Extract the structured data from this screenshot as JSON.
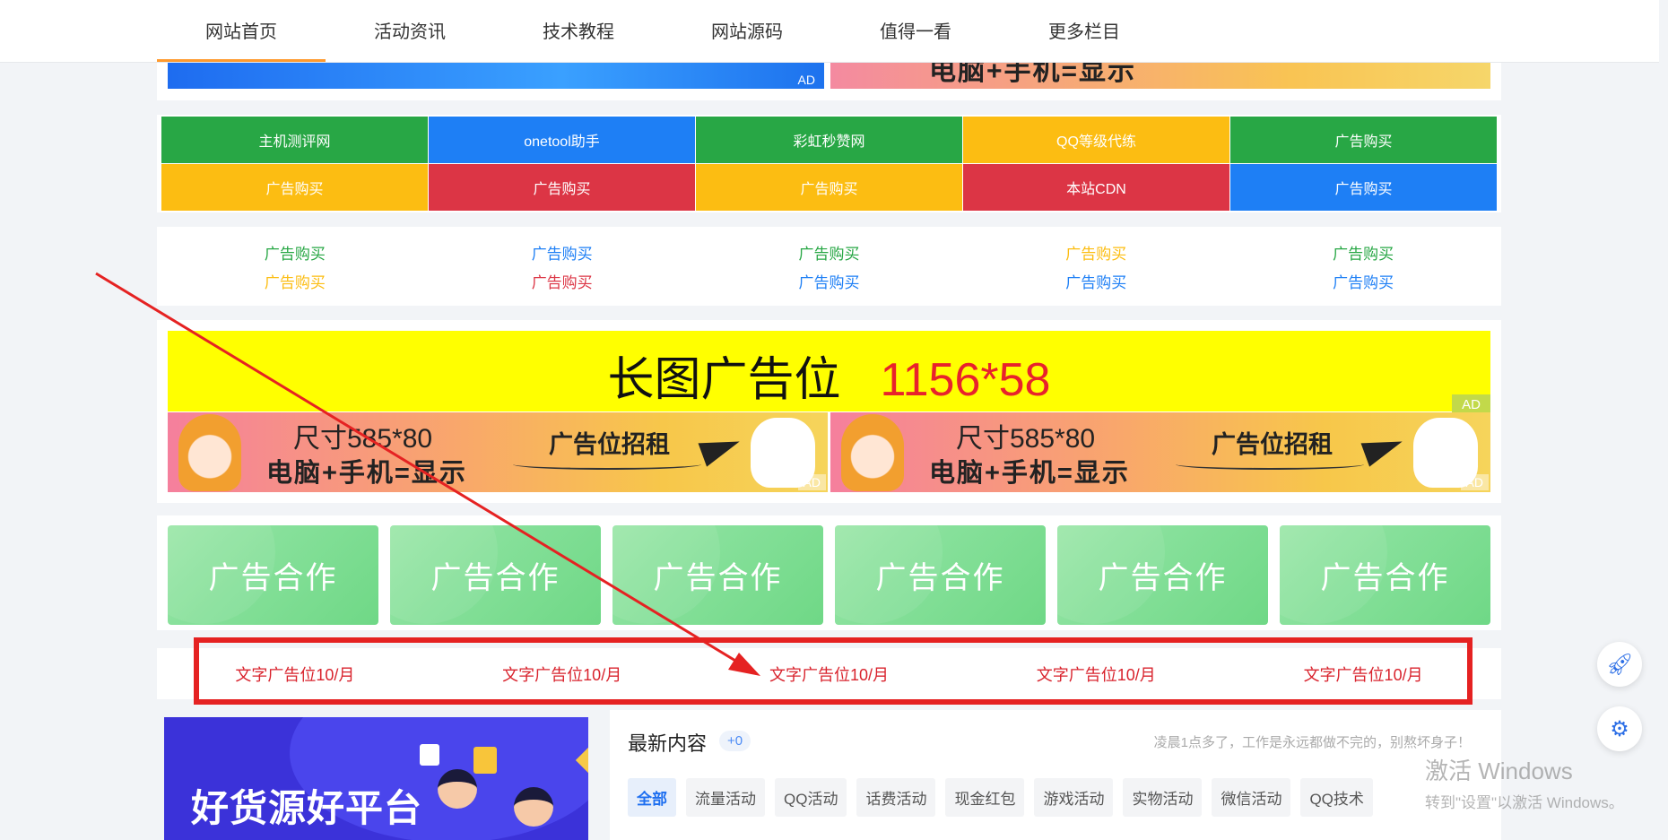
{
  "nav": {
    "items": [
      "网站首页",
      "活动资讯",
      "技术教程",
      "网站源码",
      "值得一看",
      "更多栏目"
    ]
  },
  "banner_top": {
    "right_text": "电脑+手机=显示",
    "ad_label": "AD"
  },
  "colored_links": [
    {
      "label": "主机测评网",
      "color": "#28a745"
    },
    {
      "label": "onetool助手",
      "color": "#1e7ff5"
    },
    {
      "label": "彩虹秒赞网",
      "color": "#28a745"
    },
    {
      "label": "QQ等级代练",
      "color": "#fcbd12"
    },
    {
      "label": "广告购买",
      "color": "#28a745"
    },
    {
      "label": "广告购买",
      "color": "#fcbd12"
    },
    {
      "label": "广告购买",
      "color": "#dc3545"
    },
    {
      "label": "广告购买",
      "color": "#fcbd12"
    },
    {
      "label": "本站CDN",
      "color": "#dc3545"
    },
    {
      "label": "广告购买",
      "color": "#1e7ff5"
    }
  ],
  "text_links": [
    {
      "label": "广告购买",
      "color": "#28a745"
    },
    {
      "label": "广告购买",
      "color": "#1e7ff5"
    },
    {
      "label": "广告购买",
      "color": "#28a745"
    },
    {
      "label": "广告购买",
      "color": "#fcbd12"
    },
    {
      "label": "广告购买",
      "color": "#28a745"
    },
    {
      "label": "广告购买",
      "color": "#fcbd12"
    },
    {
      "label": "广告购买",
      "color": "#dc3545"
    },
    {
      "label": "广告购买",
      "color": "#1e7ff5"
    },
    {
      "label": "广告购买",
      "color": "#1e7ff5"
    },
    {
      "label": "广告购买",
      "color": "#1e7ff5"
    }
  ],
  "long_banner": {
    "main": "长图广告位",
    "size": "1156*58",
    "ad_label": "AD"
  },
  "half_banners": [
    {
      "size": "尺寸585*80",
      "device": "电脑+手机=显示",
      "rent": "广告位招租",
      "ad_label": "AD"
    },
    {
      "size": "尺寸585*80",
      "device": "电脑+手机=显示",
      "rent": "广告位招租",
      "ad_label": "AD"
    }
  ],
  "coop_cards": [
    "广告合作",
    "广告合作",
    "广告合作",
    "广告合作",
    "广告合作",
    "广告合作"
  ],
  "text_ads": [
    "文字广告位10/月",
    "文字广告位10/月",
    "文字广告位10/月",
    "文字广告位10/月",
    "文字广告位10/月"
  ],
  "promo": {
    "title": "好货源好平台"
  },
  "latest": {
    "title": "最新内容",
    "count": "+0",
    "motto": "凌晨1点多了，工作是永远都做不完的，别熬坏身子！",
    "tabs": [
      "全部",
      "流量活动",
      "QQ活动",
      "话费活动",
      "现金红包",
      "游戏活动",
      "实物活动",
      "微信活动",
      "QQ技术"
    ]
  },
  "float_buttons": {
    "rocket_icon": "rocket-icon",
    "gear_icon": "gear-icon"
  },
  "watermark": {
    "line1": "激活 Windows",
    "line2": "转到\"设置\"以激活 Windows。"
  },
  "annotation": {
    "arrow_color": "#e52222",
    "frame_color": "#e52222"
  }
}
